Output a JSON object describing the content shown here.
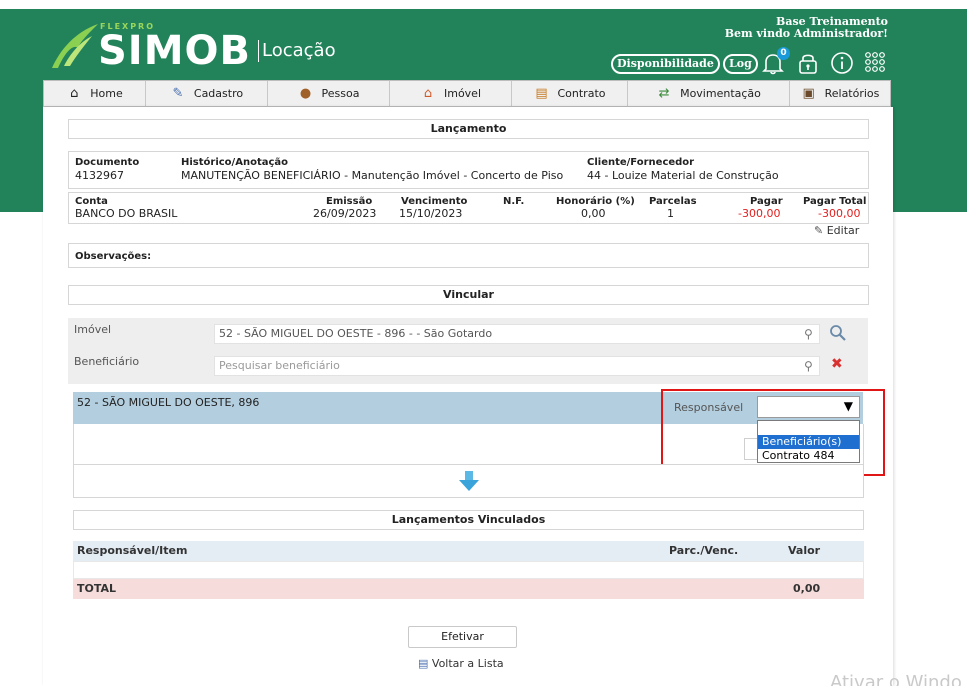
{
  "header": {
    "logo_brand": "FLEXPRO",
    "logo_name": "SIMOB",
    "logo_module": "Locação",
    "org_name": "Base Treinamento",
    "welcome": "Bem vindo Administrador!",
    "disponibilidade_label": "Disponibilidade",
    "log_label": "Log",
    "notification_count": "0",
    "colors": {
      "header_bg": "#22835a",
      "logo_accent": "#9ad65a"
    }
  },
  "nav": {
    "items": [
      {
        "label": "Home",
        "icon": "home-icon"
      },
      {
        "label": "Cadastro",
        "icon": "pen-icon"
      },
      {
        "label": "Pessoa",
        "icon": "person-icon"
      },
      {
        "label": "Imóvel",
        "icon": "house-icon"
      },
      {
        "label": "Contrato",
        "icon": "document-icon"
      },
      {
        "label": "Movimentação",
        "icon": "transfer-icon"
      },
      {
        "label": "Relatórios",
        "icon": "report-icon"
      }
    ]
  },
  "lancamento": {
    "title": "Lançamento",
    "documento_label": "Documento",
    "documento": "4132967",
    "historico_label": "Histórico/Anotação",
    "historico": "MANUTENÇÃO BENEFICIÁRIO - Manutenção Imóvel - Concerto de Piso",
    "cliente_label": "Cliente/Fornecedor",
    "cliente": "44 - Louize Material de Construção",
    "conta_label": "Conta",
    "conta": "BANCO DO BRASIL",
    "emissao_label": "Emissão",
    "emissao": "26/09/2023",
    "vencimento_label": "Vencimento",
    "vencimento": "15/10/2023",
    "nf_label": "N.F.",
    "nf": "",
    "honorario_label": "Honorário (%)",
    "honorario": "0,00",
    "parcelas_label": "Parcelas",
    "parcelas": "1",
    "pagar_label": "Pagar",
    "pagar": "-300,00",
    "pagar_total_label": "Pagar Total",
    "pagar_total": "-300,00",
    "editar_label": "Editar",
    "observacoes_label": "Observações:"
  },
  "vincular": {
    "title": "Vincular",
    "imovel_label": "Imóvel",
    "imovel_value": "52 - SÃO MIGUEL DO OESTE - 896 -  - São Gotardo",
    "beneficiario_label": "Beneficiário",
    "beneficiario_placeholder": "Pesquisar beneficiário",
    "selected_item": "52 - SÃO MIGUEL DO OESTE, 896",
    "responsavel_label": "Responsável",
    "responsavel_selected": "",
    "responsavel_options": [
      "",
      "Beneficiário(s)",
      "Contrato 484"
    ],
    "highlighted_option": "Beneficiário(s)"
  },
  "vinculados": {
    "title": "Lançamentos Vinculados",
    "columns": [
      "Responsável/Item",
      "Parc./Venc.",
      "Valor"
    ],
    "rows": [],
    "total_label": "TOTAL",
    "total_value": "0,00"
  },
  "actions": {
    "efetivar_label": "Efetivar",
    "voltar_label": "Voltar a Lista"
  },
  "watermark": "Ativar o Windo"
}
